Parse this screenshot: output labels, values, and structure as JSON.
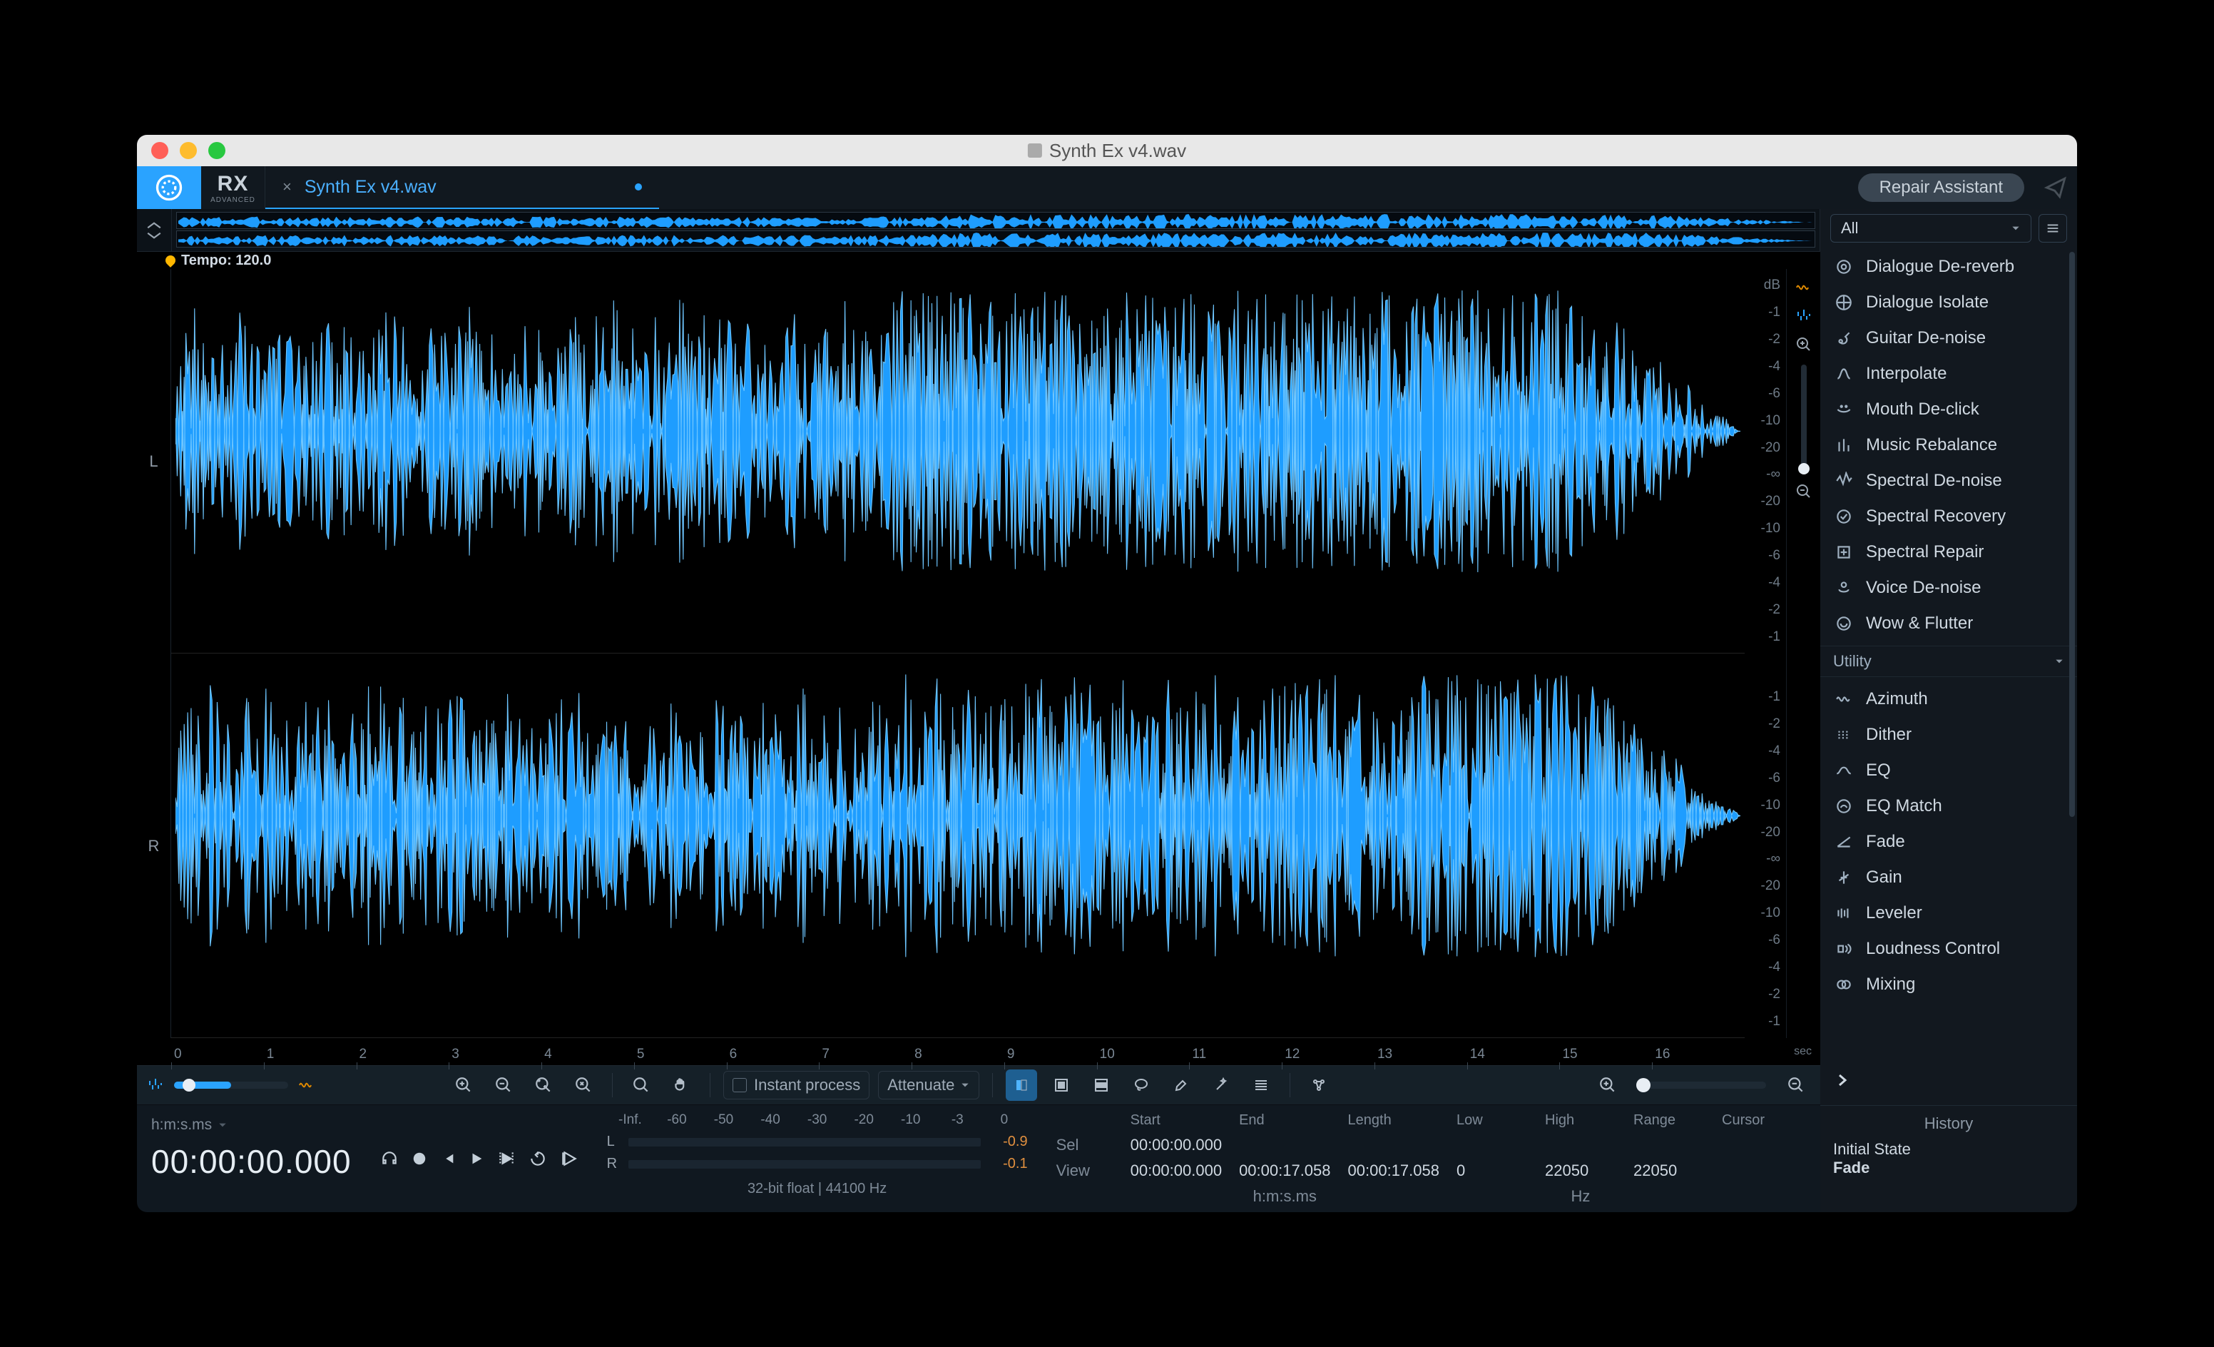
{
  "window": {
    "title": "Synth Ex v4.wav"
  },
  "brand": {
    "name": "RX",
    "edition": "ADVANCED"
  },
  "tab": {
    "label": "Synth Ex v4.wav"
  },
  "topbar": {
    "repair_assistant": "Repair Assistant"
  },
  "tempo": {
    "label": "Tempo: 120.0"
  },
  "channels": {
    "left": "L",
    "right": "R"
  },
  "db_ticks_top_unit": "dB",
  "db_ticks": [
    "-1",
    "-2",
    "-4",
    "-6",
    "-10",
    "-20",
    "-∞",
    "-20",
    "-10",
    "-6",
    "-4",
    "-2",
    "-1"
  ],
  "ruler": {
    "marks": [
      "0",
      "1",
      "2",
      "3",
      "4",
      "5",
      "6",
      "7",
      "8",
      "9",
      "10",
      "11",
      "12",
      "13",
      "14",
      "15",
      "16"
    ],
    "unit": "sec"
  },
  "toolbar": {
    "instant_process": "Instant process",
    "attenuate": "Attenuate"
  },
  "transport": {
    "format_label": "h:m:s.ms",
    "timecode": "00:00:00.000"
  },
  "meters": {
    "scale": [
      "-Inf.",
      "-60",
      "-50",
      "-40",
      "-30",
      "-20",
      "-10",
      "-3",
      "0"
    ],
    "L": {
      "label": "L",
      "value": "-0.9"
    },
    "R": {
      "label": "R",
      "value": "-0.1"
    },
    "format": "32-bit float | 44100 Hz"
  },
  "selection": {
    "headers": {
      "start": "Start",
      "end": "End",
      "length": "Length",
      "low": "Low",
      "high": "High",
      "range": "Range",
      "cursor": "Cursor"
    },
    "rows": {
      "sel": {
        "label": "Sel",
        "start": "00:00:00.000",
        "end": "",
        "length": "",
        "low": "",
        "high": "",
        "range": ""
      },
      "view": {
        "label": "View",
        "start": "00:00:00.000",
        "end": "00:00:17.058",
        "length": "00:00:17.058",
        "low": "0",
        "high": "22050",
        "range": "22050"
      }
    },
    "unit_time": "h:m:s.ms",
    "unit_freq": "Hz"
  },
  "sidebar": {
    "filter_label": "All",
    "repair": [
      "Dialogue De-reverb",
      "Dialogue Isolate",
      "Guitar De-noise",
      "Interpolate",
      "Mouth De-click",
      "Music Rebalance",
      "Spectral De-noise",
      "Spectral Recovery",
      "Spectral Repair",
      "Voice De-noise",
      "Wow & Flutter"
    ],
    "section_utility": "Utility",
    "utility": [
      "Azimuth",
      "Dither",
      "EQ",
      "EQ Match",
      "Fade",
      "Gain",
      "Leveler",
      "Loudness Control",
      "Mixing"
    ]
  },
  "history": {
    "title": "History",
    "items": [
      "Initial State",
      "Fade"
    ]
  }
}
